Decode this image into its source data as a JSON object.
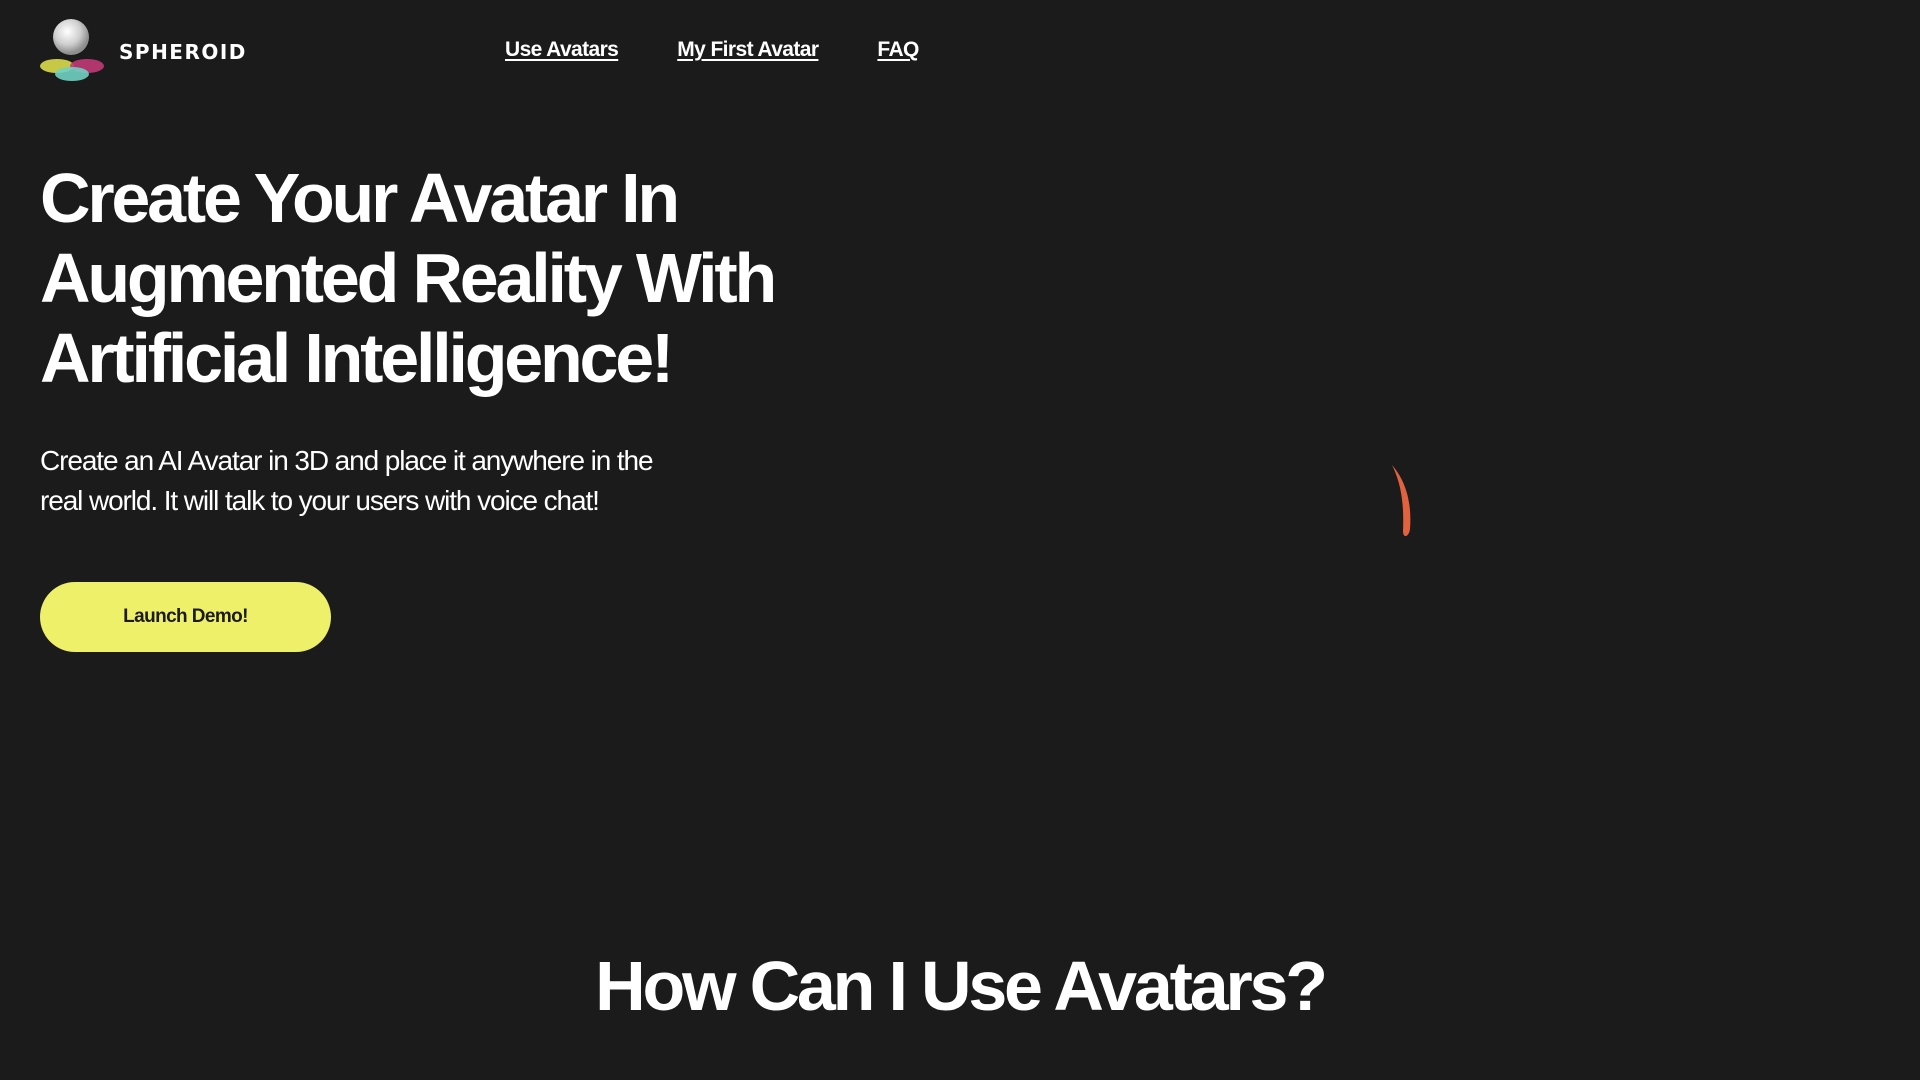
{
  "header": {
    "brand_name": "SPHEROID",
    "logo_icon": "spheroid-logo-icon",
    "nav": [
      {
        "label": "Use Avatars"
      },
      {
        "label": "My First Avatar"
      },
      {
        "label": "FAQ"
      }
    ]
  },
  "hero": {
    "title": "Create Your Avatar In Augmented Reality With Artificial Intelligence!",
    "subtitle": "Create an AI Avatar in 3D and place it anywhere in the real world. It will talk to your users with voice chat!",
    "cta_label": "Launch Demo!",
    "loading_icon": "loading-spinner-icon"
  },
  "section": {
    "title": "How Can I Use Avatars?"
  },
  "colors": {
    "background": "#1b1b1b",
    "text": "#ffffff",
    "cta_background": "#eff06a",
    "spinner": "#e0623f"
  }
}
